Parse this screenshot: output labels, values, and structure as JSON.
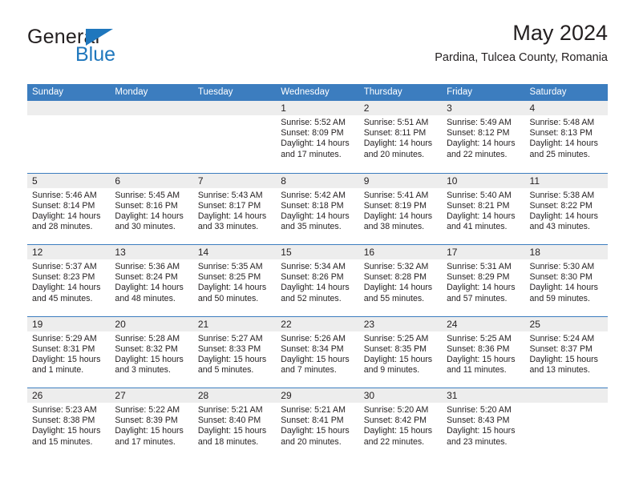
{
  "brand": {
    "name_part1": "General",
    "name_part2": "Blue",
    "accent_color": "#1f77bd"
  },
  "header": {
    "title": "May 2024",
    "subtitle": "Pardina, Tulcea County, Romania"
  },
  "calendar": {
    "header_color": "#3c7dbf",
    "daynum_band_color": "#ededed",
    "weekdays": [
      "Sunday",
      "Monday",
      "Tuesday",
      "Wednesday",
      "Thursday",
      "Friday",
      "Saturday"
    ],
    "weeks": [
      [
        {
          "day": "",
          "empty": true
        },
        {
          "day": "",
          "empty": true
        },
        {
          "day": "",
          "empty": true
        },
        {
          "day": "1",
          "sunrise": "Sunrise: 5:52 AM",
          "sunset": "Sunset: 8:09 PM",
          "daylight_1": "Daylight: 14 hours",
          "daylight_2": "and 17 minutes."
        },
        {
          "day": "2",
          "sunrise": "Sunrise: 5:51 AM",
          "sunset": "Sunset: 8:11 PM",
          "daylight_1": "Daylight: 14 hours",
          "daylight_2": "and 20 minutes."
        },
        {
          "day": "3",
          "sunrise": "Sunrise: 5:49 AM",
          "sunset": "Sunset: 8:12 PM",
          "daylight_1": "Daylight: 14 hours",
          "daylight_2": "and 22 minutes."
        },
        {
          "day": "4",
          "sunrise": "Sunrise: 5:48 AM",
          "sunset": "Sunset: 8:13 PM",
          "daylight_1": "Daylight: 14 hours",
          "daylight_2": "and 25 minutes."
        }
      ],
      [
        {
          "day": "5",
          "sunrise": "Sunrise: 5:46 AM",
          "sunset": "Sunset: 8:14 PM",
          "daylight_1": "Daylight: 14 hours",
          "daylight_2": "and 28 minutes."
        },
        {
          "day": "6",
          "sunrise": "Sunrise: 5:45 AM",
          "sunset": "Sunset: 8:16 PM",
          "daylight_1": "Daylight: 14 hours",
          "daylight_2": "and 30 minutes."
        },
        {
          "day": "7",
          "sunrise": "Sunrise: 5:43 AM",
          "sunset": "Sunset: 8:17 PM",
          "daylight_1": "Daylight: 14 hours",
          "daylight_2": "and 33 minutes."
        },
        {
          "day": "8",
          "sunrise": "Sunrise: 5:42 AM",
          "sunset": "Sunset: 8:18 PM",
          "daylight_1": "Daylight: 14 hours",
          "daylight_2": "and 35 minutes."
        },
        {
          "day": "9",
          "sunrise": "Sunrise: 5:41 AM",
          "sunset": "Sunset: 8:19 PM",
          "daylight_1": "Daylight: 14 hours",
          "daylight_2": "and 38 minutes."
        },
        {
          "day": "10",
          "sunrise": "Sunrise: 5:40 AM",
          "sunset": "Sunset: 8:21 PM",
          "daylight_1": "Daylight: 14 hours",
          "daylight_2": "and 41 minutes."
        },
        {
          "day": "11",
          "sunrise": "Sunrise: 5:38 AM",
          "sunset": "Sunset: 8:22 PM",
          "daylight_1": "Daylight: 14 hours",
          "daylight_2": "and 43 minutes."
        }
      ],
      [
        {
          "day": "12",
          "sunrise": "Sunrise: 5:37 AM",
          "sunset": "Sunset: 8:23 PM",
          "daylight_1": "Daylight: 14 hours",
          "daylight_2": "and 45 minutes."
        },
        {
          "day": "13",
          "sunrise": "Sunrise: 5:36 AM",
          "sunset": "Sunset: 8:24 PM",
          "daylight_1": "Daylight: 14 hours",
          "daylight_2": "and 48 minutes."
        },
        {
          "day": "14",
          "sunrise": "Sunrise: 5:35 AM",
          "sunset": "Sunset: 8:25 PM",
          "daylight_1": "Daylight: 14 hours",
          "daylight_2": "and 50 minutes."
        },
        {
          "day": "15",
          "sunrise": "Sunrise: 5:34 AM",
          "sunset": "Sunset: 8:26 PM",
          "daylight_1": "Daylight: 14 hours",
          "daylight_2": "and 52 minutes."
        },
        {
          "day": "16",
          "sunrise": "Sunrise: 5:32 AM",
          "sunset": "Sunset: 8:28 PM",
          "daylight_1": "Daylight: 14 hours",
          "daylight_2": "and 55 minutes."
        },
        {
          "day": "17",
          "sunrise": "Sunrise: 5:31 AM",
          "sunset": "Sunset: 8:29 PM",
          "daylight_1": "Daylight: 14 hours",
          "daylight_2": "and 57 minutes."
        },
        {
          "day": "18",
          "sunrise": "Sunrise: 5:30 AM",
          "sunset": "Sunset: 8:30 PM",
          "daylight_1": "Daylight: 14 hours",
          "daylight_2": "and 59 minutes."
        }
      ],
      [
        {
          "day": "19",
          "sunrise": "Sunrise: 5:29 AM",
          "sunset": "Sunset: 8:31 PM",
          "daylight_1": "Daylight: 15 hours",
          "daylight_2": "and 1 minute."
        },
        {
          "day": "20",
          "sunrise": "Sunrise: 5:28 AM",
          "sunset": "Sunset: 8:32 PM",
          "daylight_1": "Daylight: 15 hours",
          "daylight_2": "and 3 minutes."
        },
        {
          "day": "21",
          "sunrise": "Sunrise: 5:27 AM",
          "sunset": "Sunset: 8:33 PM",
          "daylight_1": "Daylight: 15 hours",
          "daylight_2": "and 5 minutes."
        },
        {
          "day": "22",
          "sunrise": "Sunrise: 5:26 AM",
          "sunset": "Sunset: 8:34 PM",
          "daylight_1": "Daylight: 15 hours",
          "daylight_2": "and 7 minutes."
        },
        {
          "day": "23",
          "sunrise": "Sunrise: 5:25 AM",
          "sunset": "Sunset: 8:35 PM",
          "daylight_1": "Daylight: 15 hours",
          "daylight_2": "and 9 minutes."
        },
        {
          "day": "24",
          "sunrise": "Sunrise: 5:25 AM",
          "sunset": "Sunset: 8:36 PM",
          "daylight_1": "Daylight: 15 hours",
          "daylight_2": "and 11 minutes."
        },
        {
          "day": "25",
          "sunrise": "Sunrise: 5:24 AM",
          "sunset": "Sunset: 8:37 PM",
          "daylight_1": "Daylight: 15 hours",
          "daylight_2": "and 13 minutes."
        }
      ],
      [
        {
          "day": "26",
          "sunrise": "Sunrise: 5:23 AM",
          "sunset": "Sunset: 8:38 PM",
          "daylight_1": "Daylight: 15 hours",
          "daylight_2": "and 15 minutes."
        },
        {
          "day": "27",
          "sunrise": "Sunrise: 5:22 AM",
          "sunset": "Sunset: 8:39 PM",
          "daylight_1": "Daylight: 15 hours",
          "daylight_2": "and 17 minutes."
        },
        {
          "day": "28",
          "sunrise": "Sunrise: 5:21 AM",
          "sunset": "Sunset: 8:40 PM",
          "daylight_1": "Daylight: 15 hours",
          "daylight_2": "and 18 minutes."
        },
        {
          "day": "29",
          "sunrise": "Sunrise: 5:21 AM",
          "sunset": "Sunset: 8:41 PM",
          "daylight_1": "Daylight: 15 hours",
          "daylight_2": "and 20 minutes."
        },
        {
          "day": "30",
          "sunrise": "Sunrise: 5:20 AM",
          "sunset": "Sunset: 8:42 PM",
          "daylight_1": "Daylight: 15 hours",
          "daylight_2": "and 22 minutes."
        },
        {
          "day": "31",
          "sunrise": "Sunrise: 5:20 AM",
          "sunset": "Sunset: 8:43 PM",
          "daylight_1": "Daylight: 15 hours",
          "daylight_2": "and 23 minutes."
        },
        {
          "day": "",
          "empty": true
        }
      ]
    ]
  }
}
